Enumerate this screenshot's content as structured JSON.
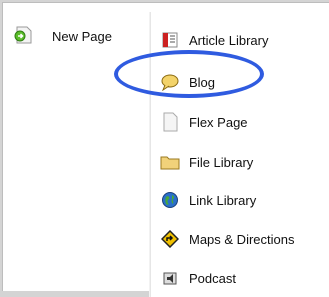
{
  "parent_menu": {
    "label": "New Page",
    "icon": "green-arrow-page-icon"
  },
  "submenu": {
    "items": [
      {
        "label": "Article Library",
        "icon": "article-library-icon"
      },
      {
        "label": "Blog",
        "icon": "speech-bubble-icon"
      },
      {
        "label": "Flex Page",
        "icon": "blank-page-icon"
      },
      {
        "label": "File Library",
        "icon": "folder-icon"
      },
      {
        "label": "Link Library",
        "icon": "globe-icon"
      },
      {
        "label": "Maps & Directions",
        "icon": "road-sign-icon"
      },
      {
        "label": "Podcast",
        "icon": "speaker-icon"
      }
    ]
  },
  "annotation": {
    "color": "#2f5be0",
    "target": "Blog"
  }
}
